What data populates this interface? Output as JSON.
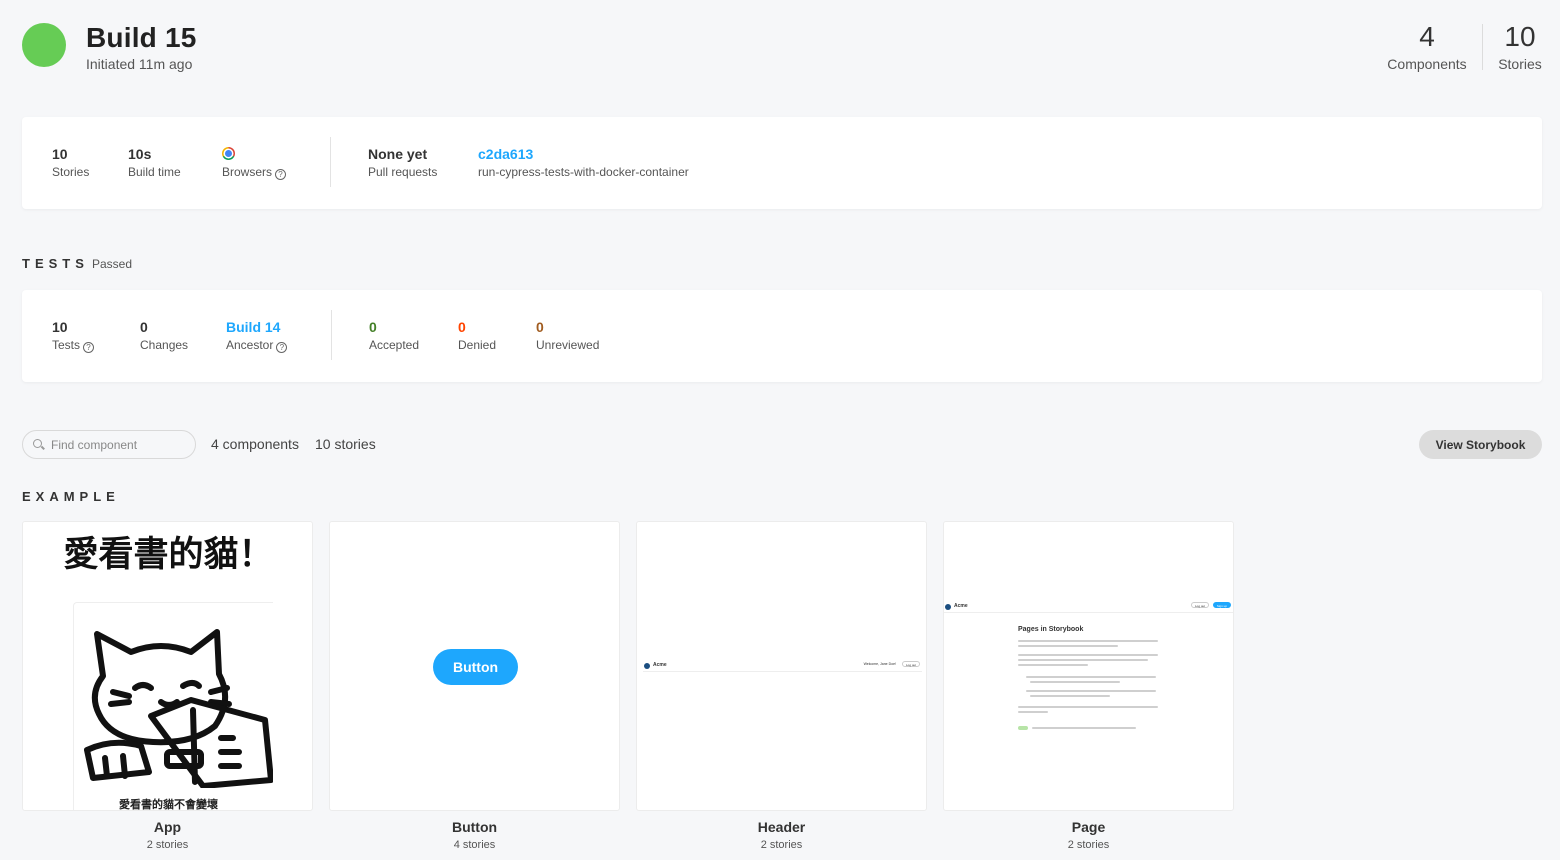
{
  "build": {
    "title": "Build 15",
    "subtitle": "Initiated 11m ago",
    "status_color": "#66cc55",
    "components_count": "4",
    "components_label": "Components",
    "stories_count": "10",
    "stories_label": "Stories"
  },
  "summary": {
    "stories_value": "10",
    "stories_label": "Stories",
    "build_time_value": "10s",
    "build_time_label": "Build time",
    "browsers_label": "Browsers",
    "browser_icon": "chrome-icon",
    "pull_requests_value": "None yet",
    "pull_requests_label": "Pull requests",
    "commit_value": "c2da613",
    "branch_label": "run-cypress-tests-with-docker-container"
  },
  "tests": {
    "section_title": "TESTS",
    "status": "Passed",
    "tests_value": "10",
    "tests_label": "Tests",
    "changes_value": "0",
    "changes_label": "Changes",
    "ancestor_value": "Build 14",
    "ancestor_label": "Ancestor",
    "accepted_value": "0",
    "accepted_label": "Accepted",
    "denied_value": "0",
    "denied_label": "Denied",
    "unreviewed_value": "0",
    "unreviewed_label": "Unreviewed"
  },
  "toolbar": {
    "search_placeholder": "Find component",
    "components_text": "4 components",
    "stories_text": "10 stories",
    "view_storybook_label": "View Storybook"
  },
  "example": {
    "section_title": "EXAMPLE",
    "components": [
      {
        "name": "App",
        "stories": "2 stories",
        "preview_heading": "愛看書的貓！",
        "preview_caption": "愛看書的貓不會變壞"
      },
      {
        "name": "Button",
        "stories": "4 stories",
        "preview_button": "Button"
      },
      {
        "name": "Header",
        "stories": "2 stories",
        "preview_brand": "Acme",
        "preview_welcome": "Welcome, Jane Doe!",
        "preview_logout": "Log out"
      },
      {
        "name": "Page",
        "stories": "2 stories",
        "preview_brand": "Acme",
        "preview_logout": "Log out",
        "preview_signup": "Sign up",
        "preview_title": "Pages in Storybook"
      }
    ]
  },
  "colors": {
    "link": "#1ea7fd",
    "accepted": "#448028",
    "denied": "#ff4400",
    "unreviewed": "#a15c20"
  }
}
